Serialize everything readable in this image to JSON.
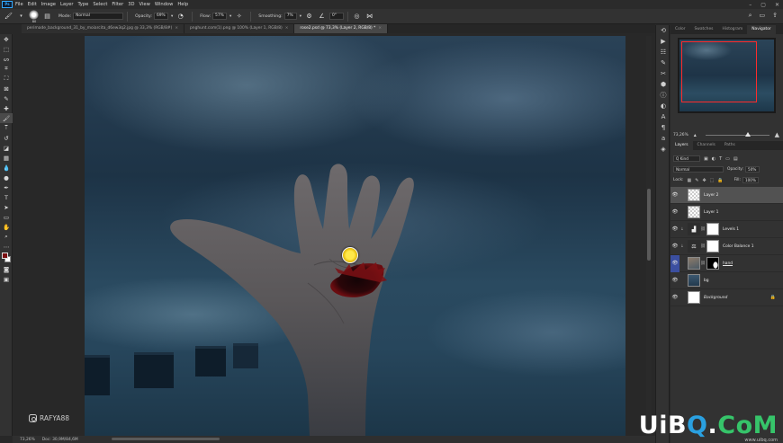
{
  "app": {
    "logo": "Ps",
    "menus": [
      "File",
      "Edit",
      "Image",
      "Layer",
      "Type",
      "Select",
      "Filter",
      "3D",
      "View",
      "Window",
      "Help"
    ]
  },
  "options": {
    "brush_size": "80",
    "mode_label": "Mode:",
    "mode_value": "Normal",
    "opacity_label": "Opacity:",
    "opacity_value": "69%",
    "flow_label": "Flow:",
    "flow_value": "57%",
    "smoothing_label": "Smoothing:",
    "smoothing_value": "7%",
    "angle_value": "0°"
  },
  "tabs": [
    {
      "label": "perimade_background_31_by_moiarcita_d6ew3q2.jpg @ 33,3% (RGB/8#)",
      "close": "×"
    },
    {
      "label": "pnghunt.com(1).png @ 100% (Layer 1, RGB/8)",
      "close": "×"
    },
    {
      "label": "rose2.psd @ 73,3% (Layer 2, RGB/8) *",
      "close": "×"
    }
  ],
  "status": {
    "zoom": "73,26%",
    "doc": "Doc: 30,9M/84,6M"
  },
  "watermark": {
    "handle": "RAFYA88",
    "site": "UiBQ.CoM",
    "site_parts": [
      "UiB",
      "Q",
      ".",
      "CoM"
    ],
    "sub": "www.uibq.com"
  },
  "panel_top": {
    "tabs": [
      "Color",
      "Swatches",
      "Histogram",
      "Navigator"
    ],
    "zoom": "73,26%"
  },
  "layers_panel": {
    "tabs": [
      "Layers",
      "Channels",
      "Paths"
    ],
    "kind_label": "Q Kind",
    "blend_mode": "Normal",
    "opacity_label": "Opacity:",
    "opacity_value": "50%",
    "lock_label": "Lock:",
    "fill_label": "Fill:",
    "fill_value": "100%",
    "layers": [
      {
        "name": "Layer 2",
        "thumb": "checker",
        "mask": "",
        "selected": true
      },
      {
        "name": "Layer 1",
        "thumb": "checker",
        "mask": "",
        "selected": false
      },
      {
        "name": "Levels 1",
        "thumb": "adj",
        "adj_symbol": "▟",
        "mask": "white",
        "selected": false
      },
      {
        "name": "Color Balance 1",
        "thumb": "adj",
        "adj_symbol": "⚖",
        "mask": "white",
        "selected": false
      },
      {
        "name": "hand",
        "thumb": "photo",
        "mask": "dark",
        "selected": false
      },
      {
        "name": "bg",
        "thumb": "sky",
        "mask": "",
        "selected": false
      },
      {
        "name": "Background",
        "thumb": "white",
        "mask": "",
        "selected": false,
        "locked": true
      }
    ]
  },
  "colors": {
    "foreground": "#7a0f12",
    "background": "#ffffff",
    "accent": "#31a8ff",
    "selected_layer": "#525252"
  }
}
